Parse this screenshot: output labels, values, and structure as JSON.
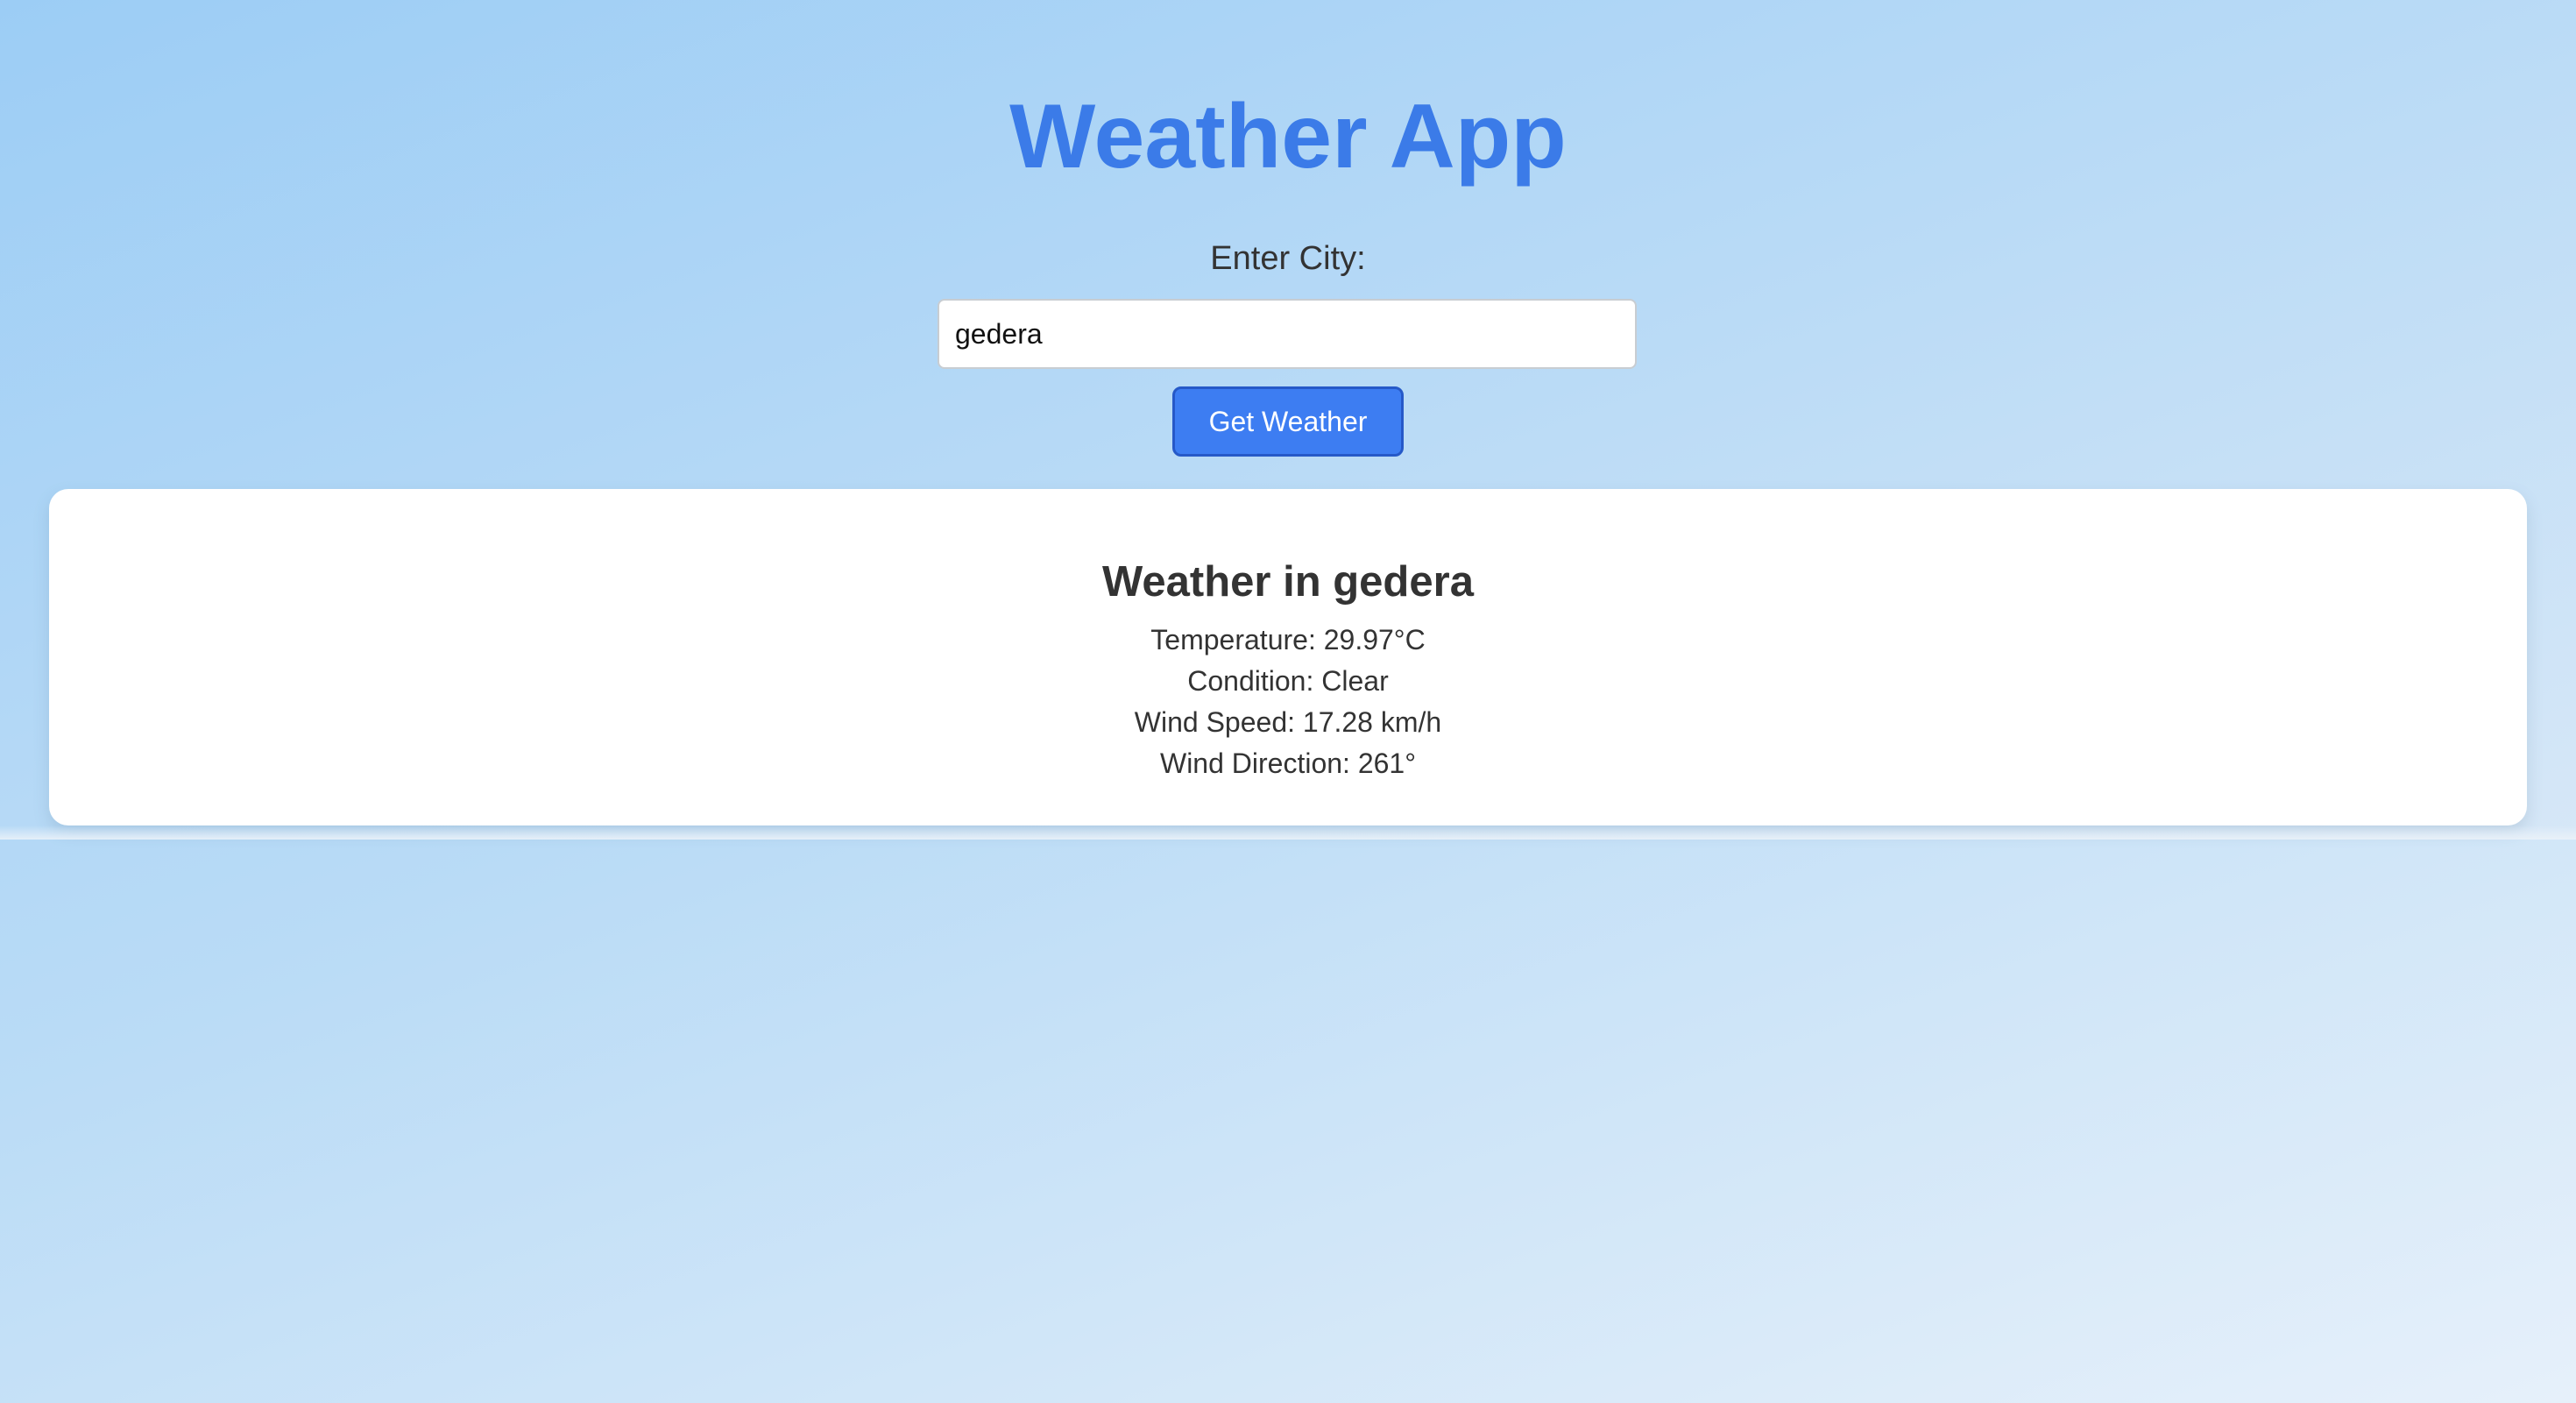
{
  "header": {
    "title": "Weather App"
  },
  "search": {
    "label": "Enter City:",
    "value": "gedera",
    "button_label": "Get Weather"
  },
  "result": {
    "title": "Weather in gedera",
    "temperature": "Temperature: 29.97°C",
    "condition": "Condition: Clear",
    "wind_speed": "Wind Speed: 17.28 km/h",
    "wind_direction": "Wind Direction: 261°"
  },
  "colors": {
    "accent": "#3b7be8",
    "button": "#3d7df2",
    "button_border": "#2659c8",
    "background_start": "#9dcdf5",
    "background_end": "#e6f0fa",
    "card": "#ffffff",
    "text": "#333333"
  }
}
